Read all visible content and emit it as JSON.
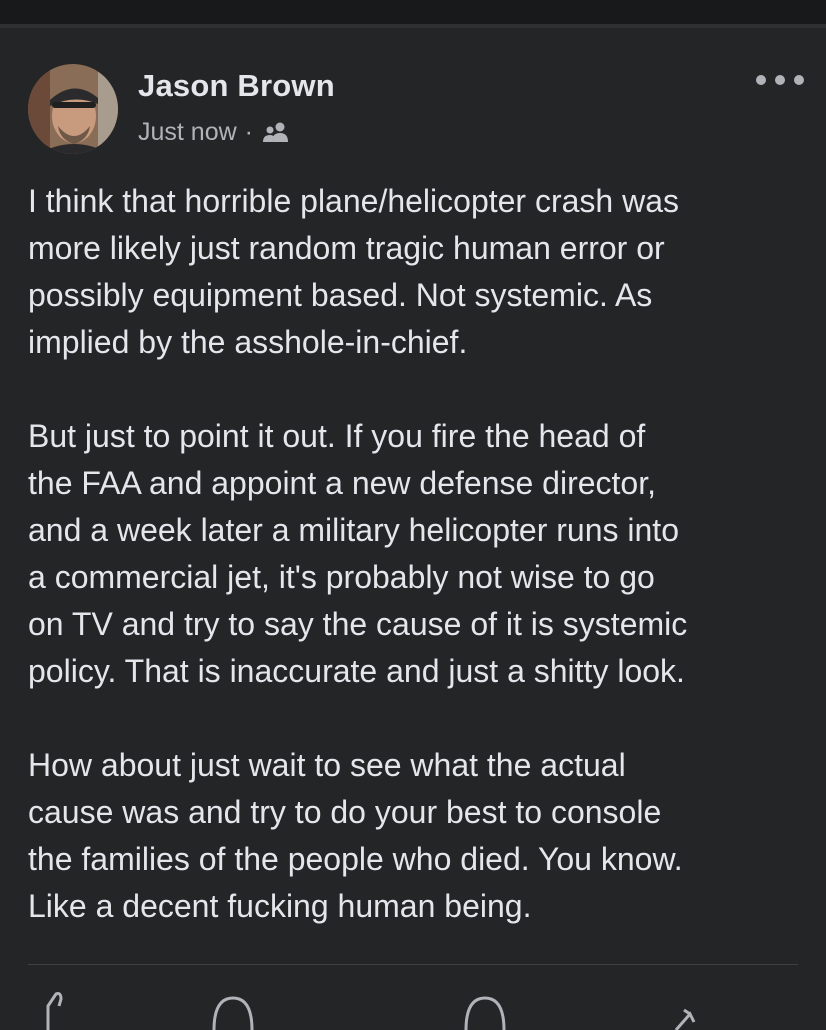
{
  "post": {
    "author": "Jason Brown",
    "timestamp": "Just now",
    "separator": "·",
    "audience_icon": "friends-icon",
    "more_icon": "more-options-icon",
    "paragraphs": [
      "I think that horrible plane/helicopter crash was\nmore likely just random tragic human error or\npossibly equipment based. Not systemic. As\nimplied by the asshole-in-chief.",
      "But just to point it out. If you fire the head of\nthe FAA and appoint a new defense director,\nand a week later a military helicopter runs into\na commercial jet, it's probably not wise to go\non TV and try to say the cause of it is systemic\npolicy. That is inaccurate and just a shitty look.",
      "How about just wait to see what the actual\ncause was and try to do your best to console\nthe families of the people who died. You know.\nLike a decent fucking human being."
    ]
  },
  "actions": {
    "icons": [
      "like-icon",
      "comment-icon",
      "messenger-icon",
      "share-icon"
    ]
  },
  "colors": {
    "background": "#242527",
    "text": "#e4e6eb",
    "secondary_text": "#b0b3b8"
  }
}
